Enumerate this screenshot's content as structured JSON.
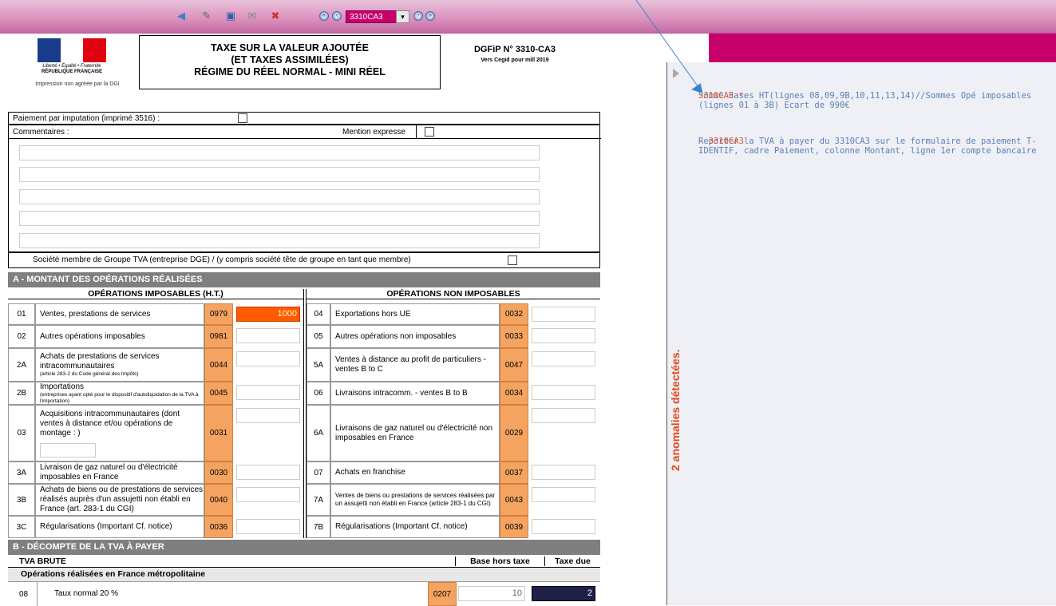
{
  "toolbar": {
    "form_select_value": "3310CA3",
    "icons": [
      "back-arrow-icon",
      "edit-icon",
      "save-icon",
      "mail-icon",
      "pin-icon",
      "first-icon",
      "prev-icon",
      "next-icon",
      "last-icon"
    ]
  },
  "header": {
    "rf_motto": "Liberté • Égalité • Fraternité",
    "rf_name": "RÉPUBLIQUE FRANÇAISE",
    "impression": "Impression non agréée par la DGI",
    "title_line1": "TAXE SUR LA VALEUR AJOUTÉE",
    "title_line2": "(ET TAXES ASSIMILÉES)",
    "title_line3": "RÉGIME DU RÉEL NORMAL - MINI RÉEL",
    "dgfip": "DGFiP N° 3310-CA3",
    "dgfip_sub": "Vers Cegid pour mill 2019"
  },
  "top": {
    "paiement_label": "Paiement par imputation  (imprimé 3516) :",
    "commentaires_label": "Commentaires :",
    "mention_label": "Mention expresse",
    "groupe_label": "Société membre de Groupe TVA (entreprise DGE) / (y compris société tête de groupe en tant que membre)"
  },
  "sectionA": {
    "title": "A - MONTANT DES OPÉRATIONS RÉALISÉES",
    "left_head": "OPÉRATIONS  IMPOSABLES (H.T.)",
    "right_head": "OPÉRATIONS NON IMPOSABLES",
    "left_rows": [
      {
        "num": "01",
        "label": "Ventes, prestations de services",
        "code": "0979",
        "value": "1000"
      },
      {
        "num": "02",
        "label": "Autres opérations imposables",
        "code": "0981",
        "value": ""
      },
      {
        "num": "2A",
        "label": "Achats de prestations de services intracommunautaires",
        "note": "(article 283-2 du Code général des Impôts)",
        "code": "0044",
        "value": ""
      },
      {
        "num": "2B",
        "label": "Importations",
        "note": "(entreprises ayant opté pour le dispositif d'autoliquidation de la TVA à l'importation)",
        "code": "0045",
        "value": ""
      },
      {
        "num": "03",
        "label": "Acquisitions intracommunautaires (dont ventes à distance et/ou opérations de montage : )",
        "code": "0031",
        "value": ""
      },
      {
        "num": "3A",
        "label": "Livraison de gaz naturel ou d'électricité imposables en France",
        "code": "0030",
        "value": ""
      },
      {
        "num": "3B",
        "label": "Achats de biens ou de prestations de services réalisés auprès d'un assujetti non établi en France (art. 283-1 du CGI)",
        "code": "0040",
        "value": ""
      },
      {
        "num": "3C",
        "label": "Régularisations (Important Cf. notice)",
        "code": "0036",
        "value": ""
      }
    ],
    "right_rows": [
      {
        "num": "04",
        "label": "Exportations hors UE",
        "code": "0032"
      },
      {
        "num": "05",
        "label": "Autres opérations non imposables",
        "code": "0033"
      },
      {
        "num": "5A",
        "label": "Ventes à distance au profit de particuliers - ventes B to C",
        "code": "0047"
      },
      {
        "num": "06",
        "label": "Livraisons intracomm. - ventes B to B",
        "code": "0034"
      },
      {
        "num": "6A",
        "label": "Livraisons de gaz naturel ou d'électricité non imposables en France",
        "code": "0029"
      },
      {
        "num": "07",
        "label": "Achats en franchise",
        "code": "0037"
      },
      {
        "num": "7A",
        "label": "Ventes de biens ou prestations de services réalisées par un assujetti non établi en France (article 283-1 du CGI)",
        "code": "0043"
      },
      {
        "num": "7B",
        "label": "Régularisations (Important Cf. notice)",
        "code": "0039"
      }
    ]
  },
  "sectionB": {
    "title": "B - DÉCOMPTE DE LA TVA À PAYER",
    "tva_brute": "TVA BRUTE",
    "base_ht": "Base hors taxe",
    "taxe_due": "Taxe due",
    "subhead": "Opérations réalisées en France métropolitaine",
    "row08": {
      "num": "08",
      "label": "Taux normal 20 %",
      "code": "0207",
      "base": "10",
      "taxe": "2"
    }
  },
  "panel": {
    "vertical_label": "2 anomalies détectées.",
    "anomalies": [
      {
        "code": "3310CA3 *",
        "message": "Somme Bases HT(lignes 08,09,9B,10,11,13,14)//Sommes Opé imposables (lignes 01 à 3B) Ecart de 990€"
      },
      {
        "code": "- 3310CA3",
        "message": "Reporter la TVA à payer du 3310CA3 sur le formulaire de paiement T-IDENTIF, cadre Paiement, colonne Montant, ligne 1er compte bancaire"
      }
    ]
  },
  "colors": {
    "accent": "#c8006b",
    "orange": "#f4a460",
    "highlight": "#ff5a00",
    "dark_cell": "#1f1f4a",
    "anomaly_code": "#e8502a",
    "anomaly_msg": "#5b7fb8"
  }
}
